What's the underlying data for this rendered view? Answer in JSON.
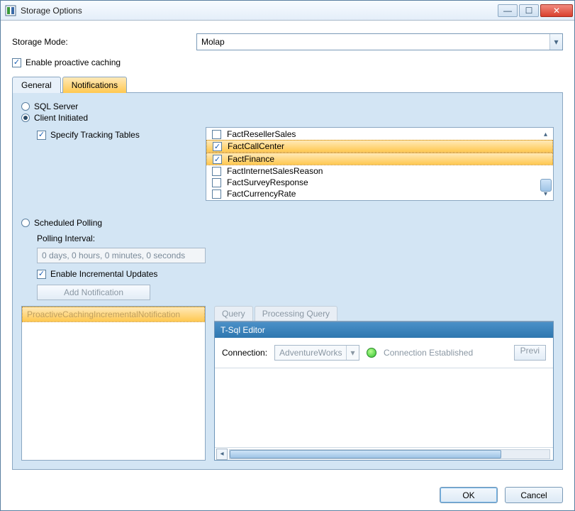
{
  "window": {
    "title": "Storage Options"
  },
  "storage_mode_label": "Storage Mode:",
  "storage_mode_value": "Molap",
  "enable_proactive": "Enable proactive caching",
  "tabs": {
    "general": "General",
    "notifications": "Notifications"
  },
  "radio": {
    "sql_server": "SQL Server",
    "client_initiated": "Client Initiated",
    "scheduled_polling": "Scheduled Polling"
  },
  "specify_tracking": "Specify Tracking Tables",
  "tracking_tables": [
    {
      "name": "FactResellerSales",
      "checked": false,
      "sel": false
    },
    {
      "name": "FactCallCenter",
      "checked": true,
      "sel": true
    },
    {
      "name": "FactFinance",
      "checked": true,
      "sel": true
    },
    {
      "name": "FactInternetSalesReason",
      "checked": false,
      "sel": false
    },
    {
      "name": "FactSurveyResponse",
      "checked": false,
      "sel": false
    },
    {
      "name": "FactCurrencyRate",
      "checked": false,
      "sel": false
    }
  ],
  "polling_interval_label": "Polling Interval:",
  "polling_interval_value": "0 days, 0 hours, 0 minutes, 0 seconds",
  "enable_incremental": "Enable Incremental Updates",
  "add_notification": "Add Notification",
  "notification_item": "ProactiveCachingIncrementalNotification",
  "subtabs": {
    "query": "Query",
    "processing_query": "Processing Query"
  },
  "editor": {
    "title": "T-Sql Editor",
    "connection_label": "Connection:",
    "connection_value": "AdventureWorks",
    "status": "Connection Established",
    "preview": "Previ"
  },
  "buttons": {
    "ok": "OK",
    "cancel": "Cancel"
  }
}
